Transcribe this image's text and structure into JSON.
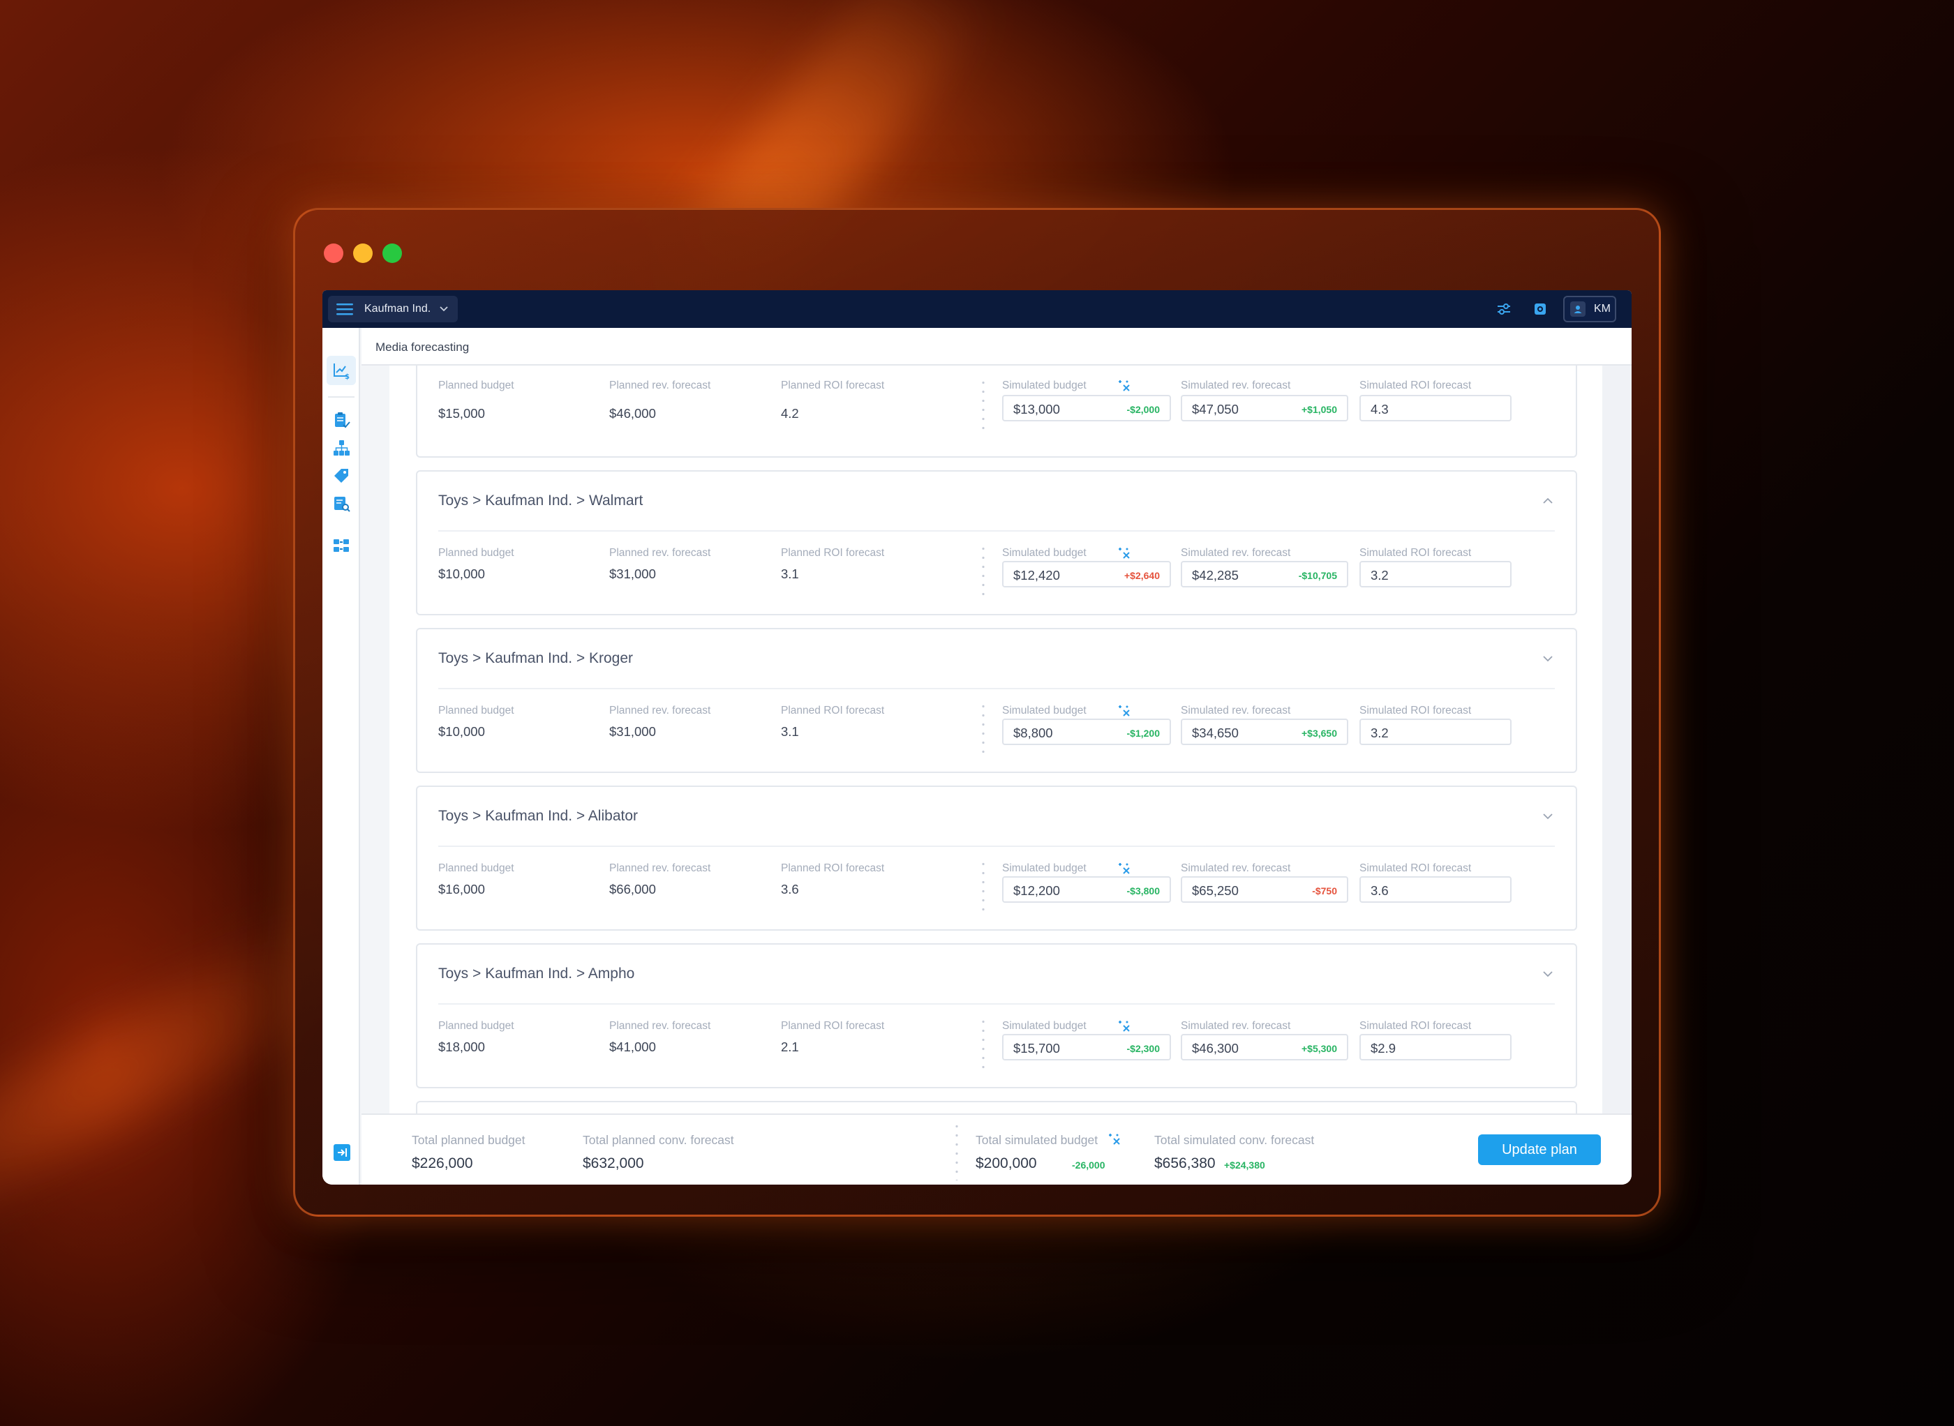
{
  "window_controls": {
    "close": "close",
    "minimize": "minimize",
    "maximize": "maximize"
  },
  "topbar": {
    "account_name": "Kaufman Ind.",
    "user_initials": "KM"
  },
  "page": {
    "title": "Media forecasting"
  },
  "labels": {
    "planned_budget": "Planned budget",
    "planned_rev": "Planned rev. forecast",
    "planned_roi": "Planned ROI forecast",
    "sim_budget": "Simulated budget",
    "sim_rev": "Simulated rev. forecast",
    "sim_roi": "Simulated ROI forecast"
  },
  "cards": [
    {
      "title": "",
      "expanded": true,
      "planned_budget": "$15,000",
      "planned_rev": "$46,000",
      "planned_roi": "4.2",
      "sim_budget": "$13,000",
      "sim_budget_delta": "-$2,000",
      "sim_budget_delta_sign": "pos",
      "sim_rev": "$47,050",
      "sim_rev_delta": "+$1,050",
      "sim_rev_delta_sign": "pos",
      "sim_roi": "4.3"
    },
    {
      "title": "Toys > Kaufman Ind. > Walmart",
      "expanded": true,
      "planned_budget": "$10,000",
      "planned_rev": "$31,000",
      "planned_roi": "3.1",
      "sim_budget": "$12,420",
      "sim_budget_delta": "+$2,640",
      "sim_budget_delta_sign": "neg",
      "sim_rev": "$42,285",
      "sim_rev_delta": "-$10,705",
      "sim_rev_delta_sign": "pos",
      "sim_roi": "3.2"
    },
    {
      "title": "Toys > Kaufman Ind. > Kroger",
      "expanded": false,
      "planned_budget": "$10,000",
      "planned_rev": "$31,000",
      "planned_roi": "3.1",
      "sim_budget": "$8,800",
      "sim_budget_delta": "-$1,200",
      "sim_budget_delta_sign": "pos",
      "sim_rev": "$34,650",
      "sim_rev_delta": "+$3,650",
      "sim_rev_delta_sign": "pos",
      "sim_roi": "3.2"
    },
    {
      "title": "Toys > Kaufman Ind. > Alibator",
      "expanded": false,
      "planned_budget": "$16,000",
      "planned_rev": "$66,000",
      "planned_roi": "3.6",
      "sim_budget": "$12,200",
      "sim_budget_delta": "-$3,800",
      "sim_budget_delta_sign": "pos",
      "sim_rev": "$65,250",
      "sim_rev_delta": "-$750",
      "sim_rev_delta_sign": "neg",
      "sim_roi": "3.6"
    },
    {
      "title": "Toys > Kaufman Ind. > Ampho",
      "expanded": false,
      "planned_budget": "$18,000",
      "planned_rev": "$41,000",
      "planned_roi": "2.1",
      "sim_budget": "$15,700",
      "sim_budget_delta": "-$2,300",
      "sim_budget_delta_sign": "pos",
      "sim_rev": "$46,300",
      "sim_rev_delta": "+$5,300",
      "sim_rev_delta_sign": "pos",
      "sim_roi": "$2.9"
    }
  ],
  "footer": {
    "total_planned_budget_label": "Total planned budget",
    "total_planned_budget": "$226,000",
    "total_planned_conv_label": "Total planned conv. forecast",
    "total_planned_conv": "$632,000",
    "total_sim_budget_label": "Total simulated budget",
    "total_sim_budget": "$200,000",
    "total_sim_budget_delta": "-26,000",
    "total_sim_conv_label": "Total simulated conv. forecast",
    "total_sim_conv": "$656,380",
    "total_sim_conv_delta": "+$24,380",
    "update_button": "Update plan"
  },
  "colors": {
    "topbar": "#0b1a3b",
    "accent": "#1ea0ec",
    "positive": "#28b463",
    "negative": "#e5533d"
  },
  "icons": [
    "menu-icon",
    "chevron-down-icon",
    "sliders-icon",
    "settings-icon",
    "user-icon",
    "chevron-up-icon",
    "simulate-icon",
    "collapse-sidebar-icon"
  ]
}
